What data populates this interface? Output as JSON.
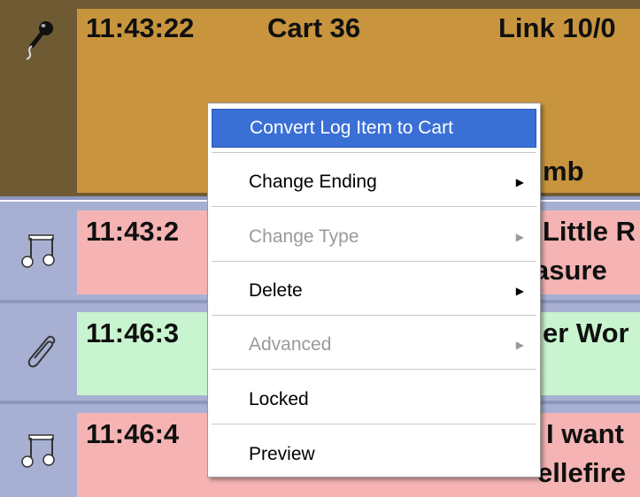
{
  "log_rows": [
    {
      "icon": "microphone-icon",
      "time": "11:43:22",
      "title": "Cart 36",
      "link": "Link 10/0",
      "sub": "mb"
    },
    {
      "icon": "music-note-icon",
      "time": "11:43:2",
      "title": "Little R",
      "sub": "asure"
    },
    {
      "icon": "paperclip-icon",
      "time": "11:46:3",
      "title": "er Wor"
    },
    {
      "icon": "music-note-icon",
      "time": "11:46:4",
      "title": "I want",
      "sub": "ellefire"
    }
  ],
  "context_menu": {
    "items": [
      {
        "label": "Convert Log Item to Cart",
        "highlighted": true,
        "enabled": true,
        "submenu": false
      },
      {
        "label": "Change Ending",
        "enabled": true,
        "submenu": true
      },
      {
        "label": "Change Type",
        "enabled": false,
        "submenu": true
      },
      {
        "label": "Delete",
        "enabled": true,
        "submenu": true
      },
      {
        "label": "Advanced",
        "enabled": false,
        "submenu": true
      },
      {
        "label": "Locked",
        "enabled": true,
        "submenu": false
      },
      {
        "label": "Preview",
        "enabled": true,
        "submenu": false
      }
    ],
    "submenu_arrow": "▶"
  },
  "colors": {
    "voice_track_bg": "#c8953e",
    "music_bg": "#f5b3b3",
    "link_bg": "#c8f5cf",
    "menu_highlight": "#3a6fd6"
  }
}
